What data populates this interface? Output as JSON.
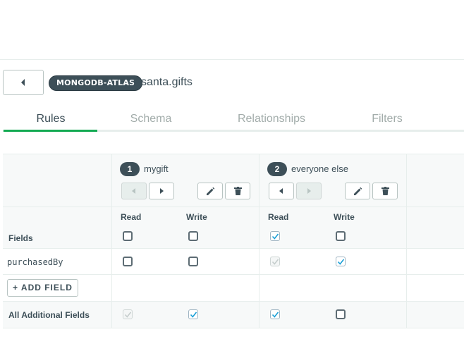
{
  "header": {
    "back_icon": "caret-left-icon",
    "service_badge": "MONGODB-ATLAS",
    "namespace": "santa.gifts"
  },
  "tabs": [
    {
      "label": "Rules",
      "active": true
    },
    {
      "label": "Schema",
      "active": false
    },
    {
      "label": "Relationships",
      "active": false
    },
    {
      "label": "Filters",
      "active": false
    }
  ],
  "roles": [
    {
      "number": "1",
      "name": "mygift",
      "move_left_enabled": false,
      "move_right_enabled": true
    },
    {
      "number": "2",
      "name": "everyone else",
      "move_left_enabled": true,
      "move_right_enabled": false
    }
  ],
  "permissions": {
    "read_label": "Read",
    "write_label": "Write"
  },
  "table": {
    "fields_header": "Fields",
    "field_rows": [
      {
        "name": "purchasedBy"
      }
    ],
    "add_field_label": "+ ADD FIELD",
    "additional_fields_label": "All Additional Fields"
  },
  "checkbox_states": {
    "header": [
      {
        "role": "mygift",
        "read": "unchecked",
        "write": "unchecked"
      },
      {
        "role": "everyone else",
        "read": "checked",
        "write": "unchecked"
      }
    ],
    "purchasedBy": [
      {
        "role": "mygift",
        "read": "unchecked",
        "write": "unchecked"
      },
      {
        "role": "everyone else",
        "read": "checked-disabled",
        "write": "checked"
      }
    ],
    "all_additional_fields": [
      {
        "role": "mygift",
        "read": "checked-disabled",
        "write": "checked"
      },
      {
        "role": "everyone else",
        "read": "checked",
        "write": "unchecked"
      }
    ]
  },
  "colors": {
    "accent_green": "#13aa52",
    "badge_dark": "#3d4f58",
    "check_blue": "#1a9fd6",
    "border": "#e7eeec"
  }
}
